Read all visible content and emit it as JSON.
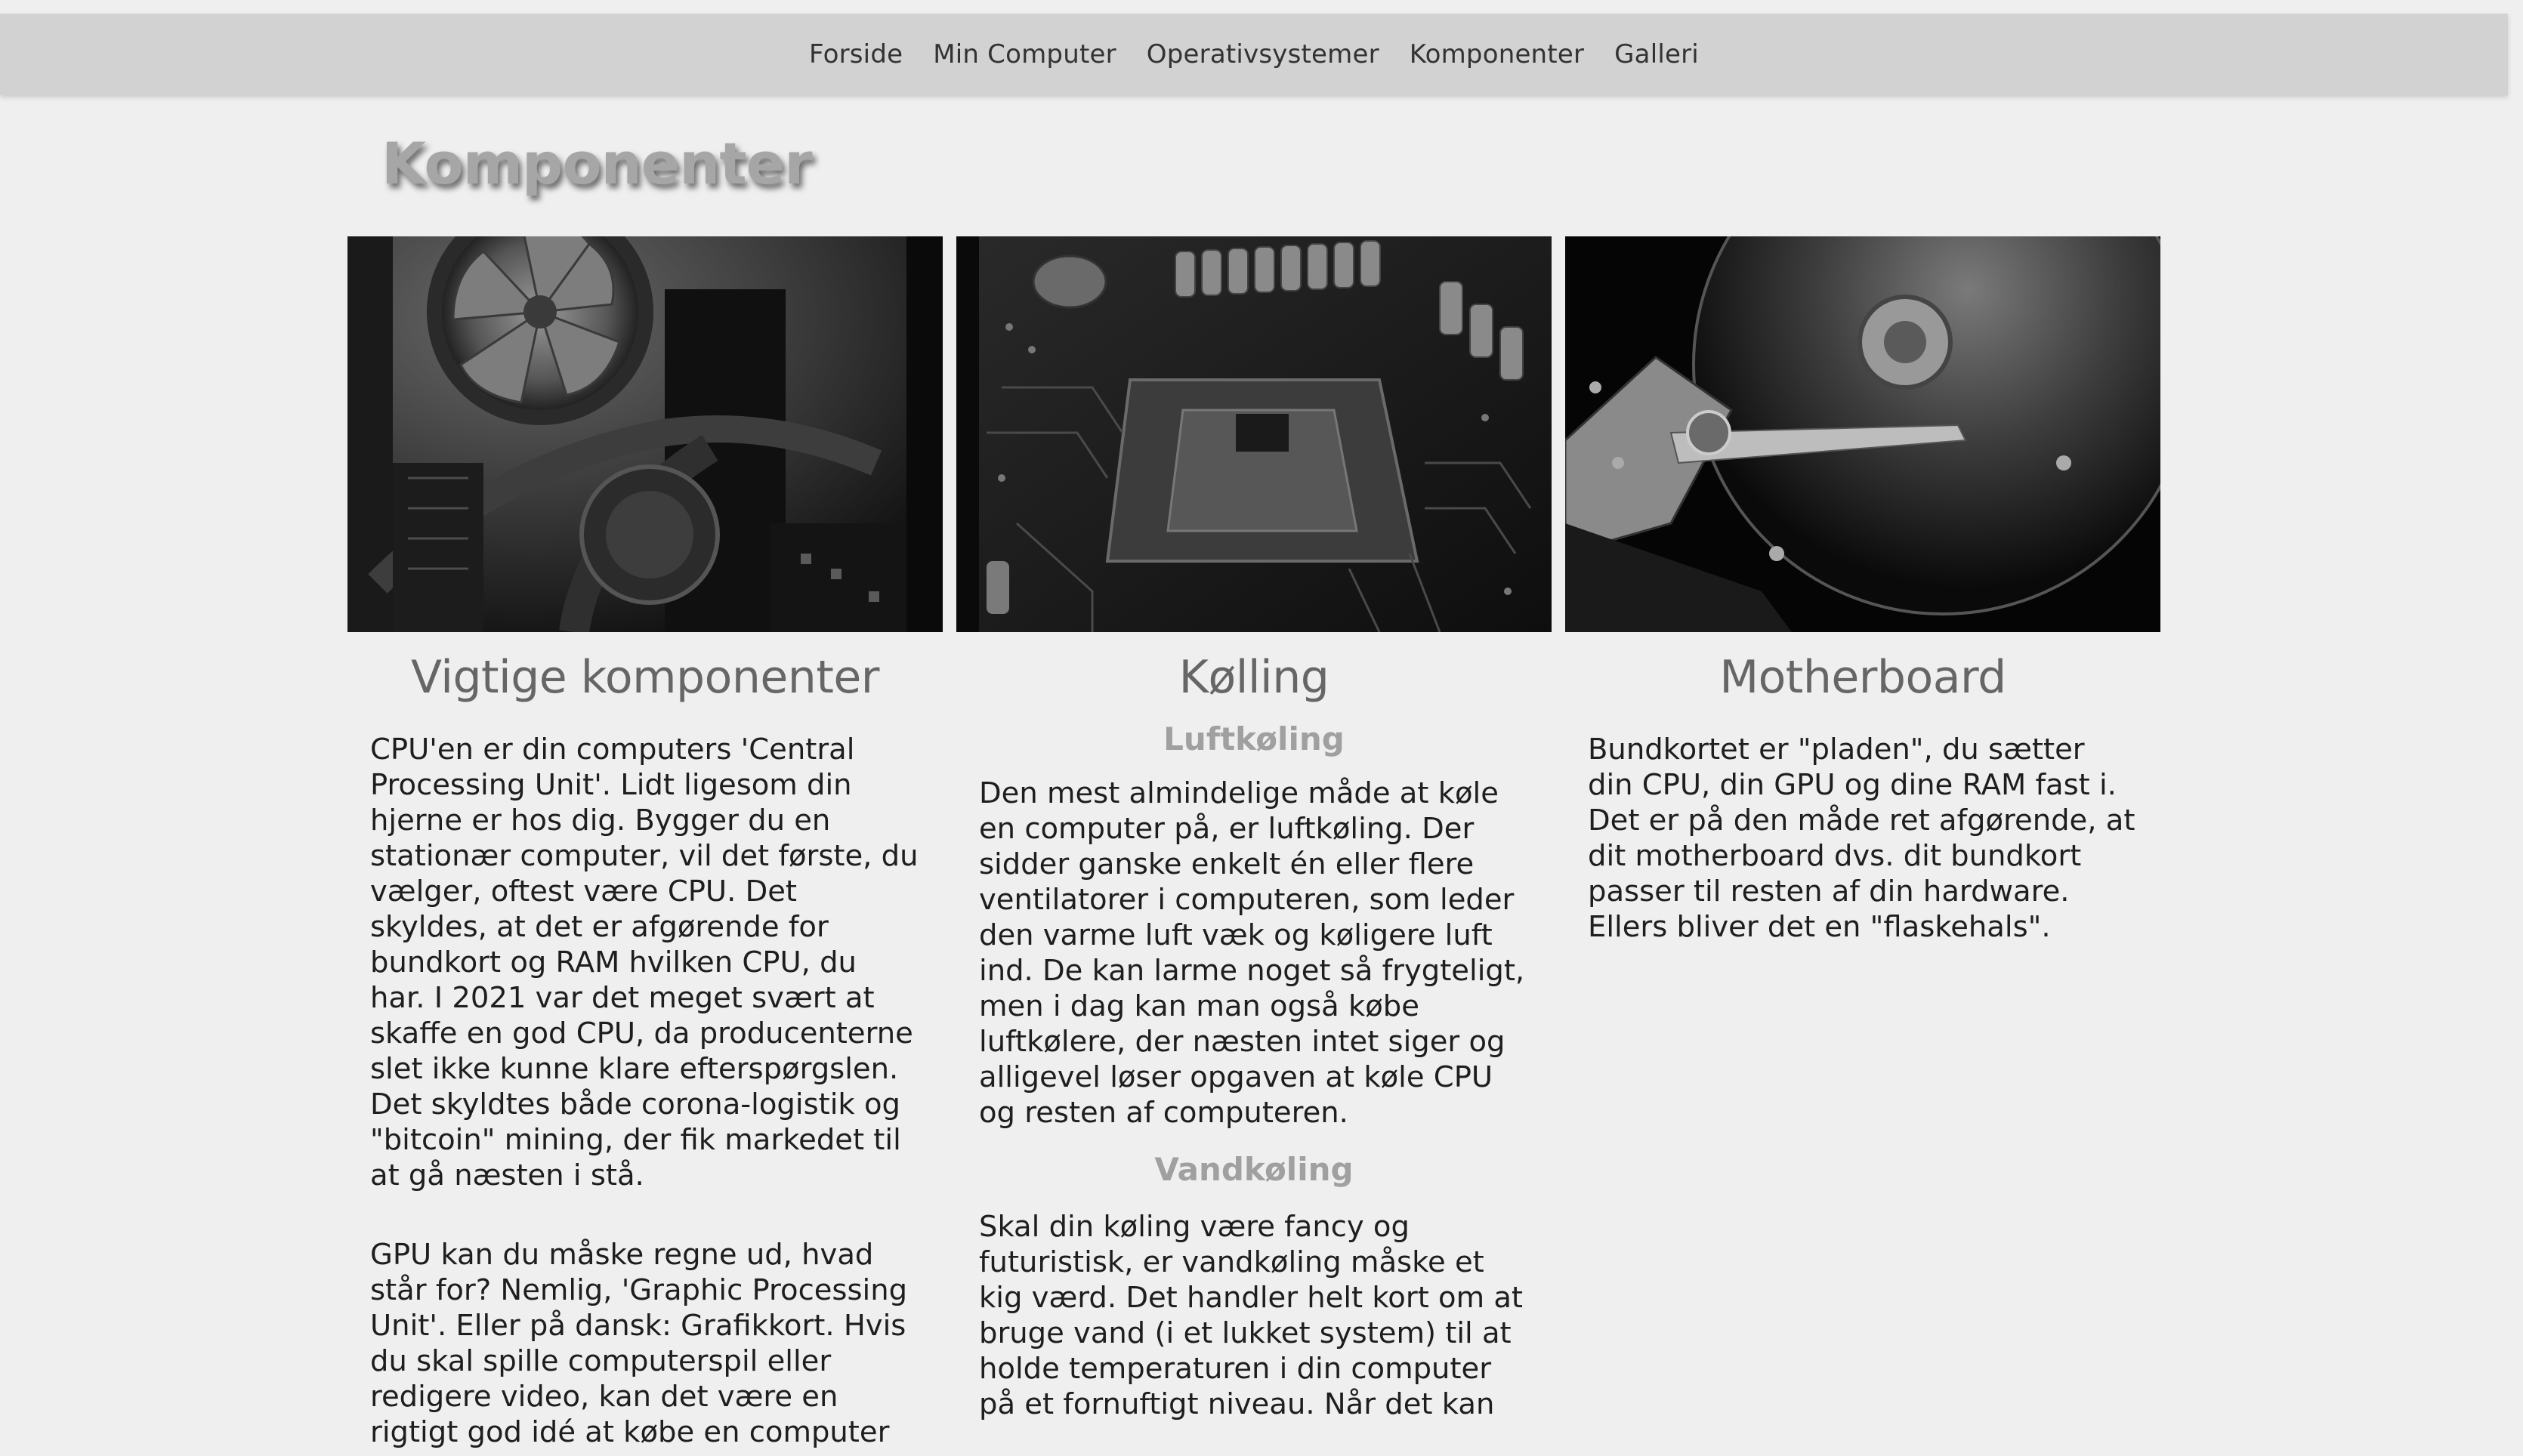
{
  "nav": {
    "items": [
      {
        "label": "Forside"
      },
      {
        "label": "Min Computer"
      },
      {
        "label": "Operativsystemer"
      },
      {
        "label": "Komponenter"
      },
      {
        "label": "Galleri"
      }
    ]
  },
  "page": {
    "title": "Komponenter"
  },
  "columns": [
    {
      "image": "cpu-cooler-fan-photo",
      "heading": "Vigtige komponenter",
      "paragraphs": [
        "CPU'en er din computers 'Central Processing Unit'. Lidt ligesom din hjerne er hos dig. Bygger du en stationær computer, vil det første, du vælger, oftest være CPU. Det skyldes, at det er afgørende for bundkort og RAM hvilken CPU, du har. I 2021 var det meget svært at skaffe en god CPU, da producenterne slet ikke kunne klare efterspørgslen. Det skyldtes både corona-logistik og \"bitcoin\" mining, der fik markedet til at gå næsten i stå.",
        "GPU kan du måske regne ud, hvad står for? Nemlig, 'Graphic Processing Unit'. Eller på dansk: Grafikkort. Hvis du skal spille computerspil eller redigere video, kan det være en rigtigt god idé at købe en computer"
      ]
    },
    {
      "image": "motherboard-socket-photo",
      "heading": "Kølling",
      "subsections": [
        {
          "subheading": "Luftkøling",
          "text": "Den mest almindelige måde at køle en computer på, er luftkøling. Der sidder ganske enkelt én eller flere ventilatorer i computeren, som leder den varme luft væk og køligere luft ind. De kan larme noget så frygteligt, men i dag kan man også købe luftkølere, der næsten intet siger og alligevel løser opgaven at køle CPU og resten af computeren."
        },
        {
          "subheading": "Vandkøling",
          "text": "Skal din køling være fancy og futuristisk, er vandkøling måske et kig værd. Det handler helt kort om at bruge vand (i et lukket system) til at holde temperaturen i din computer på et fornuftigt niveau. Når det kan"
        }
      ]
    },
    {
      "image": "hard-drive-platter-photo",
      "heading": "Motherboard",
      "paragraphs": [
        "Bundkortet er \"pladen\", du sætter din CPU, din GPU og dine RAM fast i. Det er på den måde ret afgørende, at dit motherboard dvs. dit bundkort passer til resten af din hardware. Ellers bliver det en \"flaskehals\"."
      ]
    }
  ]
}
